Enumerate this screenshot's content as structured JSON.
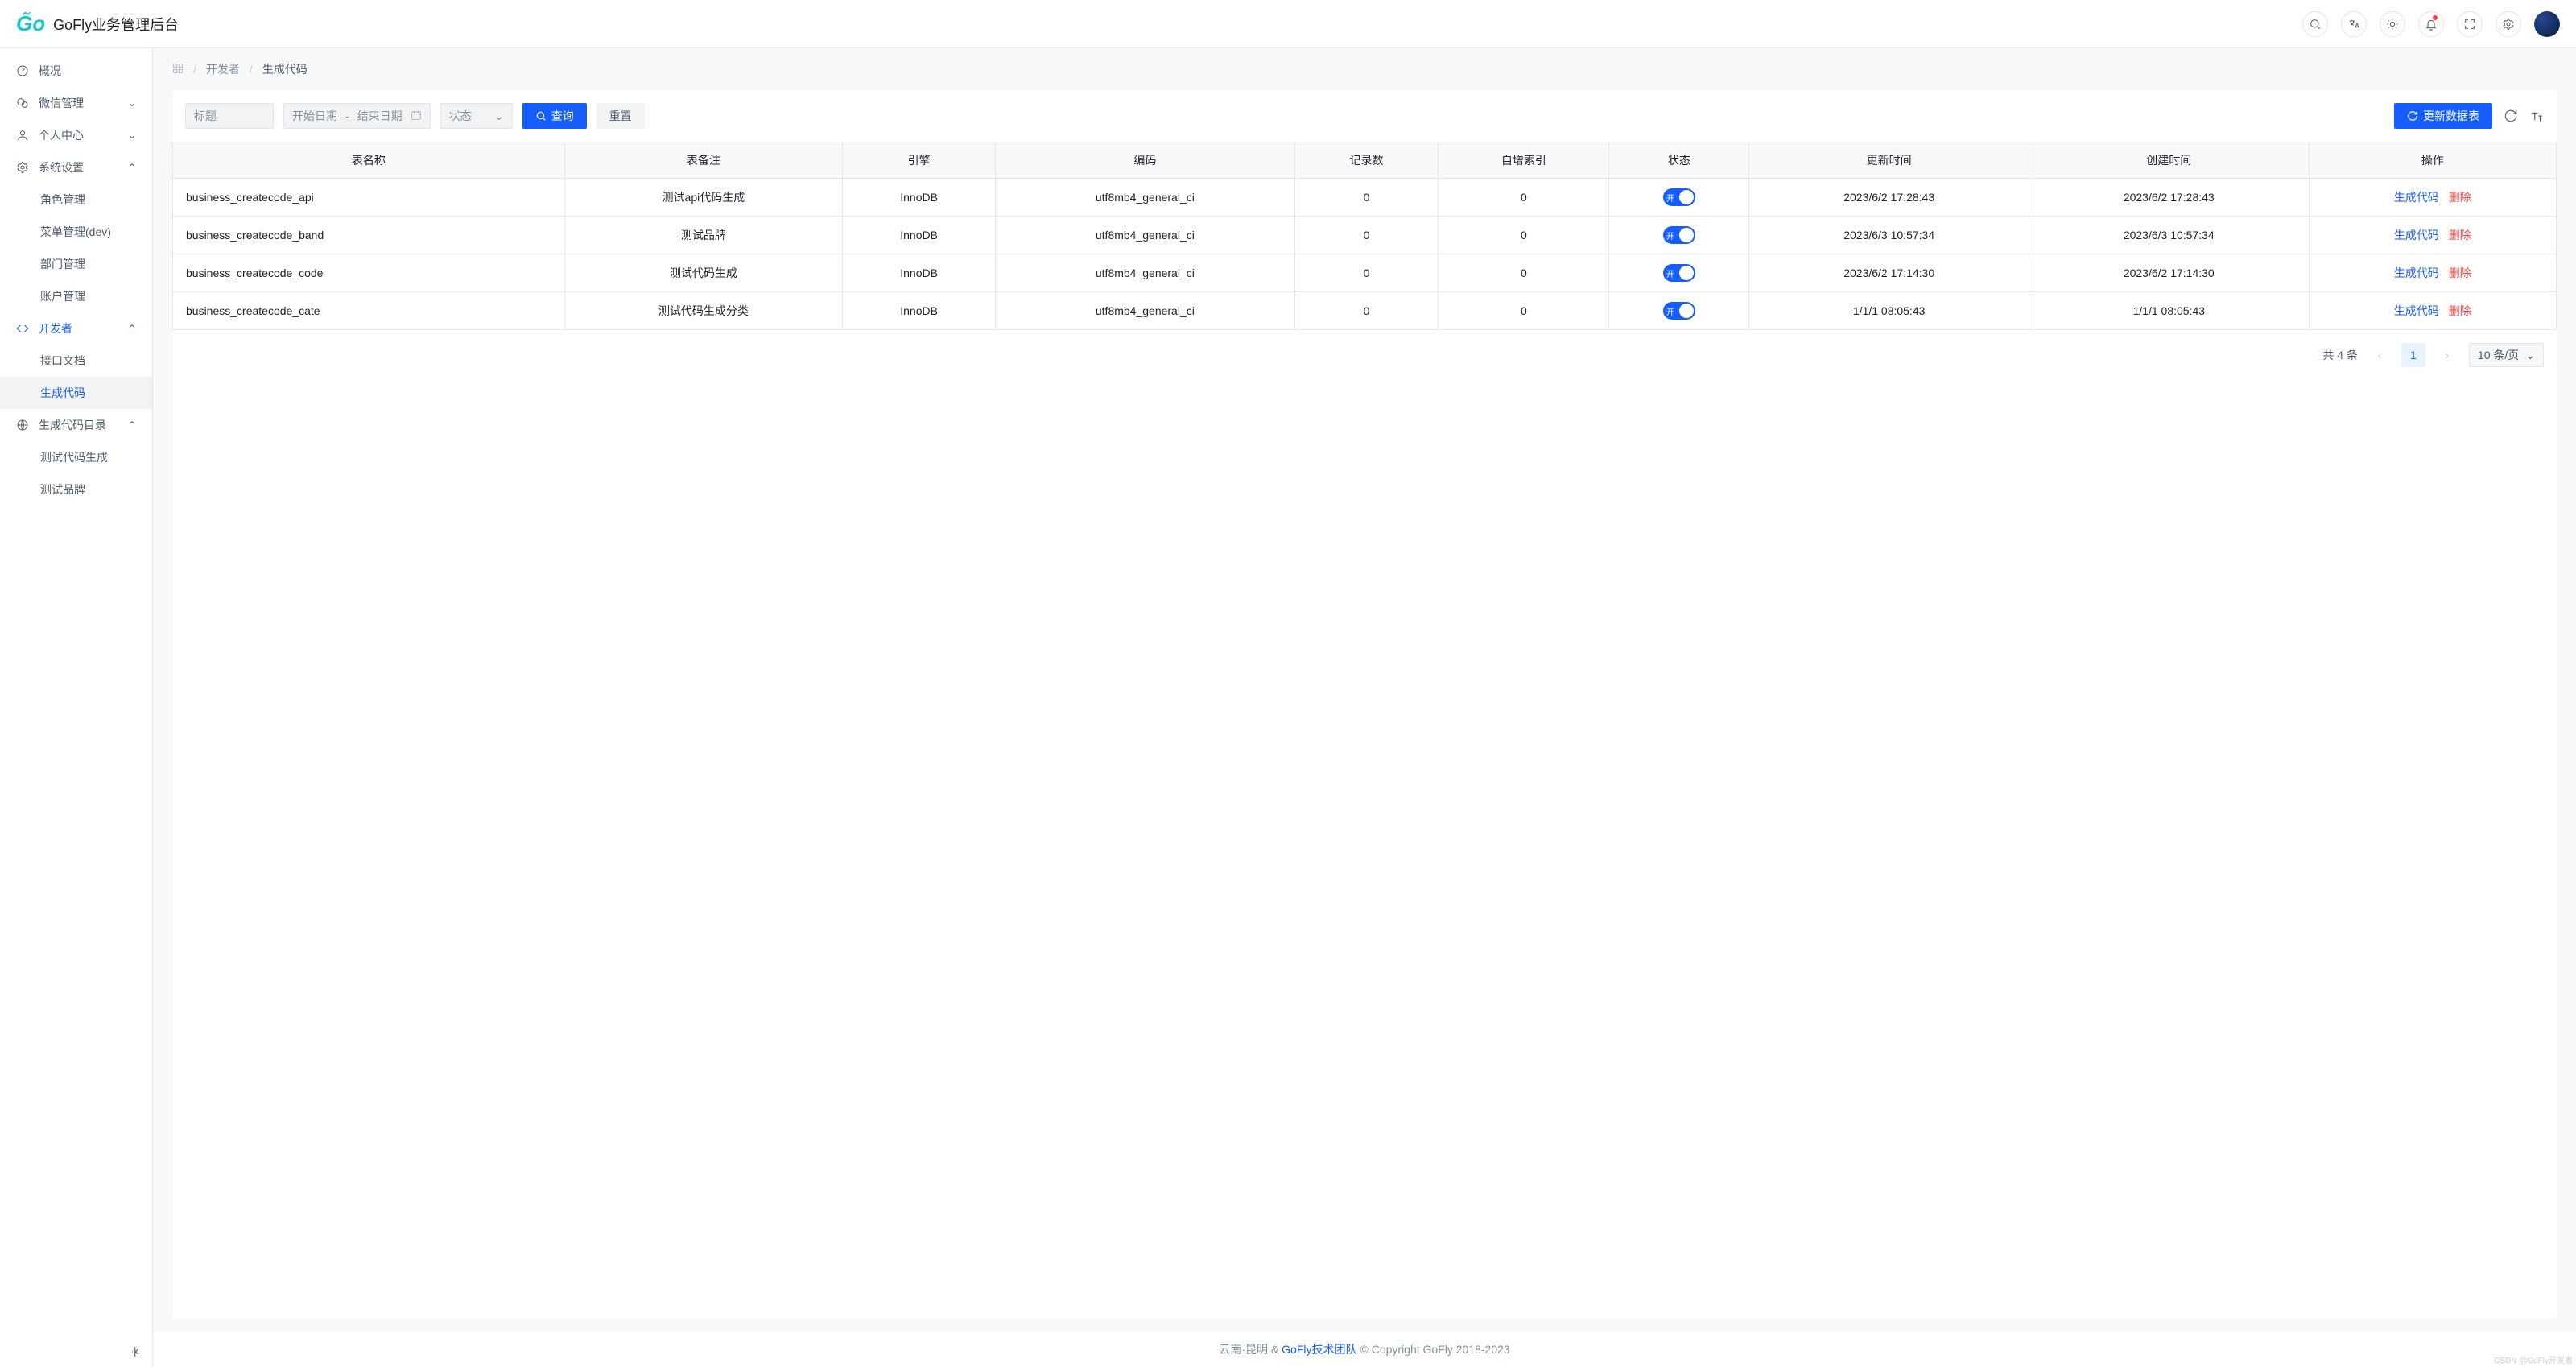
{
  "header": {
    "app_title": "GoFly业务管理后台"
  },
  "sidebar": {
    "items": [
      {
        "label": "概况",
        "icon": "dashboard"
      },
      {
        "label": "微信管理",
        "icon": "wechat",
        "expandable": true,
        "expanded": false
      },
      {
        "label": "个人中心",
        "icon": "user",
        "expandable": true,
        "expanded": false
      },
      {
        "label": "系统设置",
        "icon": "settings",
        "expandable": true,
        "expanded": true,
        "children": [
          {
            "label": "角色管理"
          },
          {
            "label": "菜单管理(dev)"
          },
          {
            "label": "部门管理"
          },
          {
            "label": "账户管理"
          }
        ]
      },
      {
        "label": "开发者",
        "icon": "code",
        "accent": true,
        "expandable": true,
        "expanded": true,
        "children": [
          {
            "label": "接口文档"
          },
          {
            "label": "生成代码",
            "active": true
          }
        ]
      },
      {
        "label": "生成代码目录",
        "icon": "lang",
        "expandable": true,
        "expanded": true,
        "children": [
          {
            "label": "测试代码生成"
          },
          {
            "label": "测试品牌"
          }
        ]
      }
    ]
  },
  "breadcrumb": {
    "items": [
      "开发者",
      "生成代码"
    ]
  },
  "toolbar": {
    "title_placeholder": "标题",
    "date_start_placeholder": "开始日期",
    "date_sep": "-",
    "date_end_placeholder": "结束日期",
    "status_placeholder": "状态",
    "query_label": "查询",
    "reset_label": "重置",
    "refresh_label": "更新数据表"
  },
  "table": {
    "headers": [
      "表名称",
      "表备注",
      "引擎",
      "编码",
      "记录数",
      "自增索引",
      "状态",
      "更新时间",
      "创建时间",
      "操作"
    ],
    "status_on_label": "开",
    "action_gen_label": "生成代码",
    "action_del_label": "删除",
    "rows": [
      {
        "name": "business_createcode_api",
        "comment": "测试api代码生成",
        "engine": "InnoDB",
        "encoding": "utf8mb4_general_ci",
        "records": "0",
        "auto_inc": "0",
        "updated": "2023/6/2 17:28:43",
        "created": "2023/6/2 17:28:43"
      },
      {
        "name": "business_createcode_band",
        "comment": "测试品牌",
        "engine": "InnoDB",
        "encoding": "utf8mb4_general_ci",
        "records": "0",
        "auto_inc": "0",
        "updated": "2023/6/3 10:57:34",
        "created": "2023/6/3 10:57:34"
      },
      {
        "name": "business_createcode_code",
        "comment": "测试代码生成",
        "engine": "InnoDB",
        "encoding": "utf8mb4_general_ci",
        "records": "0",
        "auto_inc": "0",
        "updated": "2023/6/2 17:14:30",
        "created": "2023/6/2 17:14:30"
      },
      {
        "name": "business_createcode_cate",
        "comment": "测试代码生成分类",
        "engine": "InnoDB",
        "encoding": "utf8mb4_general_ci",
        "records": "0",
        "auto_inc": "0",
        "updated": "1/1/1 08:05:43",
        "created": "1/1/1 08:05:43"
      }
    ]
  },
  "pagination": {
    "total_label": "共 4 条",
    "current_page": "1",
    "page_size": "10 条/页"
  },
  "footer": {
    "text1": "云南·昆明 &",
    "link": "GoFly技术团队",
    "text2": "© Copyright GoFly 2018-2023"
  },
  "watermark": "CSDN @GoFly开发者"
}
